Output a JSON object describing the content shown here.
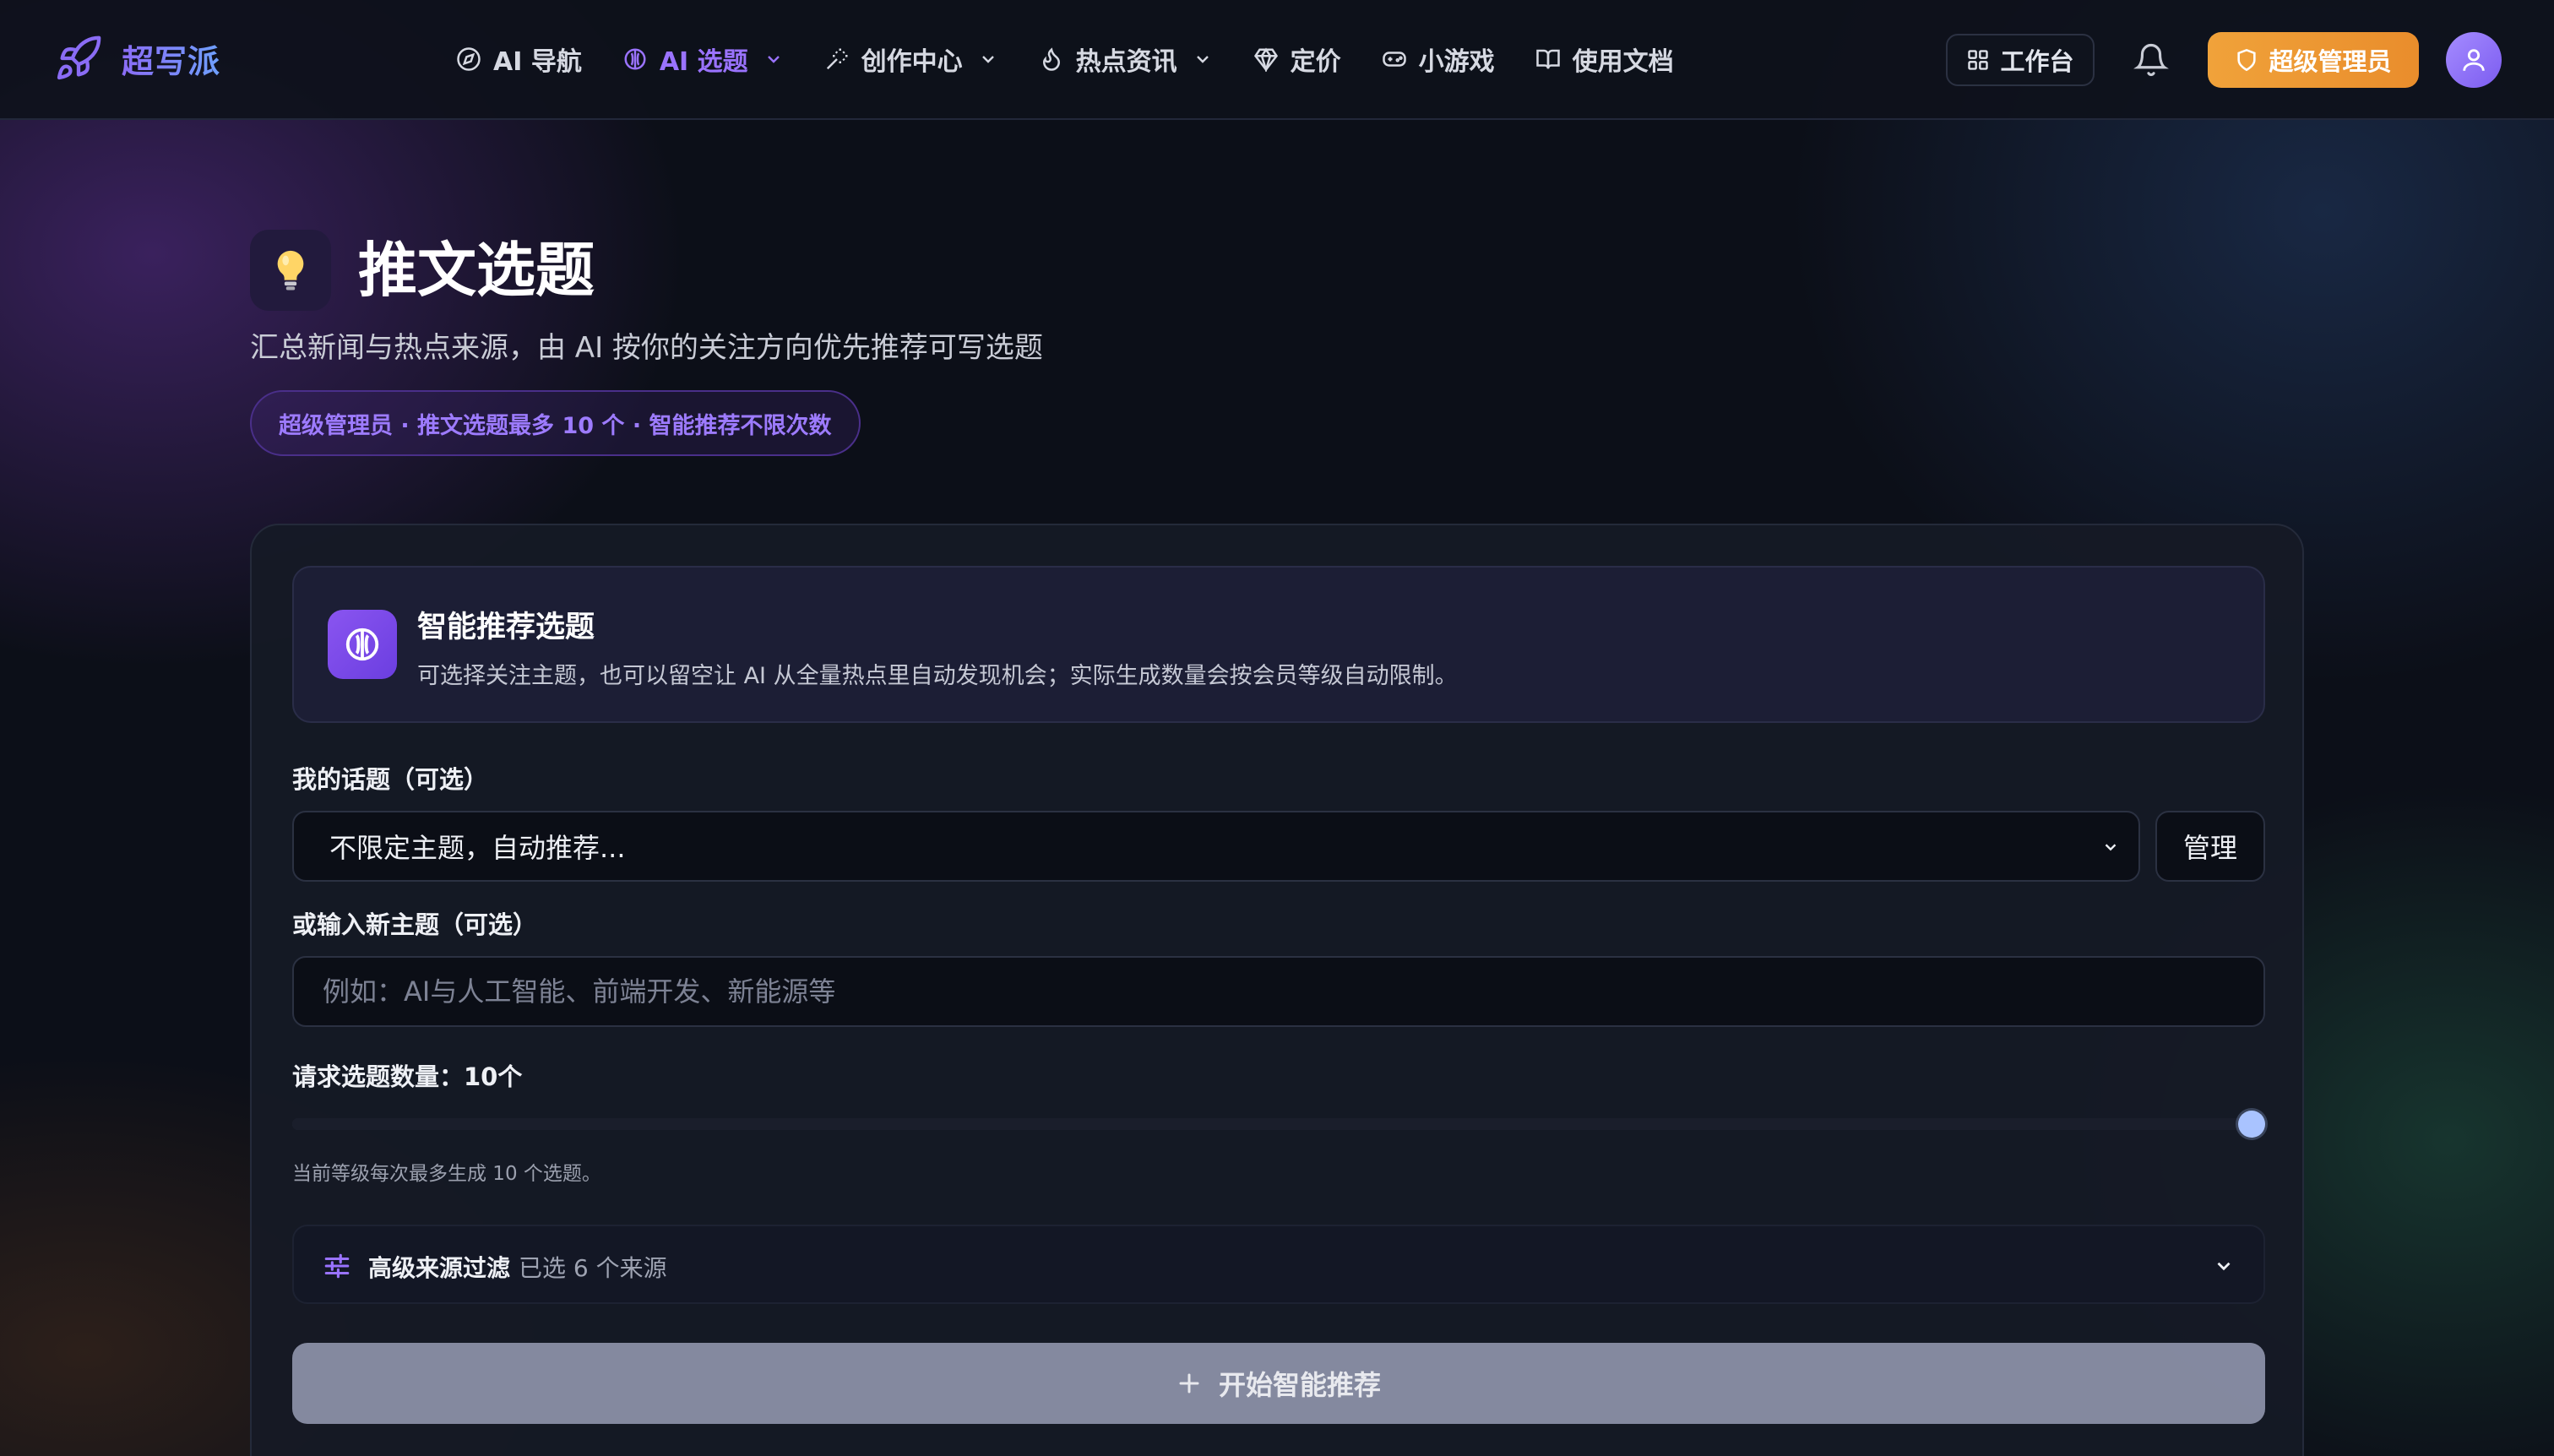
{
  "app": {
    "name": "超写派"
  },
  "nav": {
    "items": [
      {
        "label": "AI 导航"
      },
      {
        "label": "AI 选题"
      },
      {
        "label": "创作中心"
      },
      {
        "label": "热点资讯"
      },
      {
        "label": "定价"
      },
      {
        "label": "小游戏"
      },
      {
        "label": "使用文档"
      }
    ],
    "active_index": 1
  },
  "toolbar": {
    "workbench_label": "工作台",
    "admin_label": "超级管理员"
  },
  "header": {
    "title": "推文选题",
    "subtitle": "汇总新闻与热点来源，由 AI 按你的关注方向优先推荐可写选题",
    "badge": "超级管理员 · 推文选题最多 10 个 · 智能推荐不限次数"
  },
  "recommend": {
    "title": "智能推荐选题",
    "description": "可选择关注主题，也可以留空让 AI 从全量热点里自动发现机会；实际生成数量会按会员等级自动限制。",
    "topic_label": "我的话题（可选）",
    "topic_value": "不限定主题，自动推荐...",
    "manage_label": "管理",
    "new_topic_label": "或输入新主题（可选）",
    "new_topic_placeholder": "例如：AI与人工智能、前端开发、新能源等",
    "new_topic_value": "",
    "count_label": "请求选题数量：10个",
    "count_value": 10,
    "count_max": 10,
    "count_hint": "当前等级每次最多生成 10 个选题。",
    "filter_title": "高级来源过滤",
    "filter_count": "已选 6 个来源",
    "start_label": "开始智能推荐"
  },
  "colors": {
    "accent": "#9a73ff",
    "admin_button": "#f0a23a",
    "background": "#0c0f18",
    "slider_thumb": "#a9c3ff"
  }
}
